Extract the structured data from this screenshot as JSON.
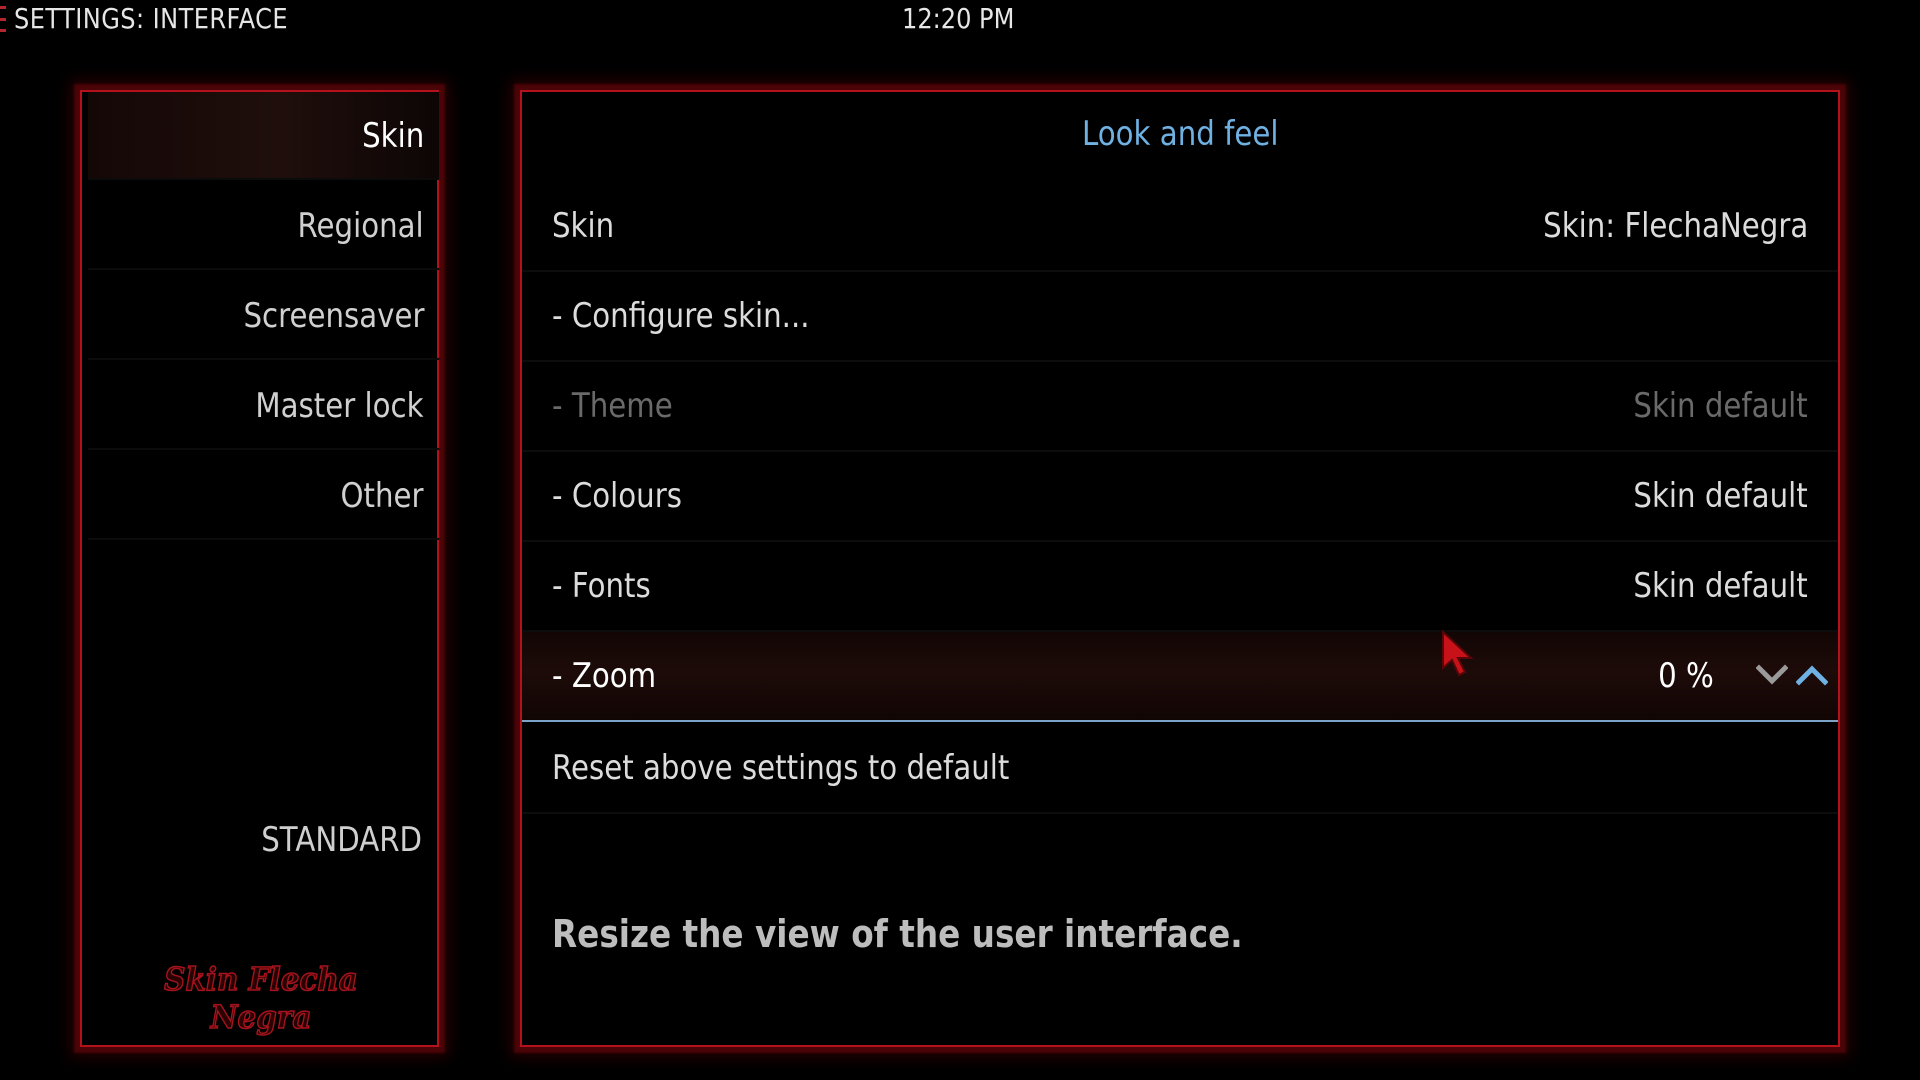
{
  "window": {
    "title": "SETTINGS: INTERFACE",
    "clock": "12:20 PM"
  },
  "sidebar": {
    "items": [
      {
        "label": "Skin",
        "active": true
      },
      {
        "label": "Regional",
        "active": false
      },
      {
        "label": "Screensaver",
        "active": false
      },
      {
        "label": "Master lock",
        "active": false
      },
      {
        "label": "Other",
        "active": false
      }
    ],
    "settings_level": "STANDARD",
    "skin_logo_text": "Skin Flecha Negra"
  },
  "main": {
    "section_title": "Look and feel",
    "settings": [
      {
        "label": "Skin",
        "value": "Skin: FlechaNegra",
        "state": "normal"
      },
      {
        "label": "- Configure skin...",
        "value": "",
        "state": "normal"
      },
      {
        "label": "- Theme",
        "value": "Skin default",
        "state": "disabled"
      },
      {
        "label": "- Colours",
        "value": "Skin default",
        "state": "normal"
      },
      {
        "label": "- Fonts",
        "value": "Skin default",
        "state": "normal"
      },
      {
        "label": "- Zoom",
        "value": "0 %",
        "state": "focused"
      },
      {
        "label": "Reset above settings to default",
        "value": "",
        "state": "normal"
      }
    ],
    "description": "Resize the view of the user interface."
  },
  "colors": {
    "accent_red": "#b3121c",
    "header_blue": "#6fb1e3",
    "focus_underline": "#7aa3c7"
  },
  "icons": {
    "spin_down": "chevron-down-icon",
    "spin_up": "chevron-up-icon",
    "cursor": "mouse-pointer-icon"
  }
}
